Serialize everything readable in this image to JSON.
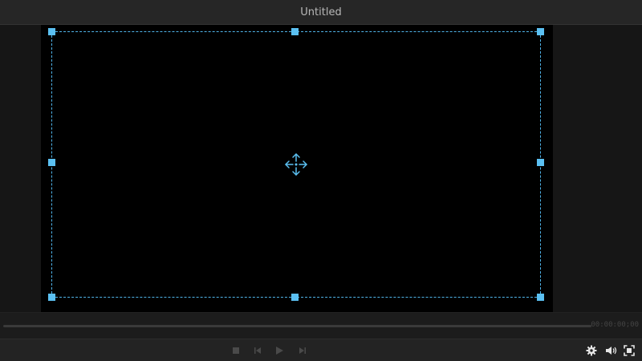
{
  "window": {
    "title": "Untitled"
  },
  "scrubber": {
    "timecode": "00:00:00;00",
    "progress": 0
  },
  "controls": {
    "stop": "stop-icon",
    "previous_frame": "previous-frame-icon",
    "play": "play-icon",
    "next_frame": "next-frame-icon",
    "settings": "gear-icon",
    "volume": "speaker-icon",
    "fullscreen": "fullscreen-icon"
  },
  "colors": {
    "accent": "#5bc0f2",
    "background": "#141414",
    "canvas": "#000000"
  }
}
